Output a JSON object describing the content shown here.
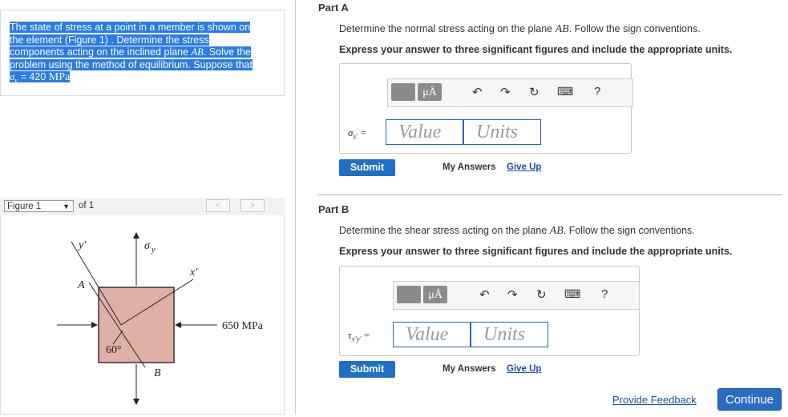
{
  "problem": {
    "line1": "The state of stress at a point in a member is shown on",
    "line2": "the element (Figure 1) . Determine the stress",
    "line3a": "components acting on the inclined plane ",
    "line3b": "AB",
    "line3c": ". Solve the",
    "line4": "problem using the method of equilibrium. Suppose that",
    "sigma_symbol": "σ",
    "sigma_sub": "y",
    "sigma_eq": " = 420 ",
    "sigma_unit": "MPa"
  },
  "figure": {
    "selected": "Figure 1",
    "of_text": "of 1",
    "prev": "<",
    "next": ">",
    "labels": {
      "y_prime": "y′",
      "sigma_y": "σ",
      "sigma_y_sub": "y",
      "x_prime": "x′",
      "A": "A",
      "B": "B",
      "angle": "60°",
      "stress": "650 MPa"
    }
  },
  "partA": {
    "title": "Part A",
    "question_a": "Determine the normal stress acting on the plane ",
    "question_ab": "AB",
    "question_b": ". Follow the sign conventions.",
    "instruction": "Express your answer to three significant figures and include the appropriate units.",
    "var_main": "σ",
    "var_sub": "x′",
    "var_eq": " =",
    "value_placeholder": "Value",
    "units_placeholder": "Units",
    "submit": "Submit",
    "my_answers": "My Answers",
    "give_up": "Give Up"
  },
  "partB": {
    "title": "Part B",
    "question_a": "Determine the shear stress acting on the plane ",
    "question_ab": "AB",
    "question_b": ". Follow the sign conventions.",
    "instruction": "Express your answer to three significant figures and include the appropriate units.",
    "var_main": "τ",
    "var_sub": "x′y′",
    "var_eq": " =",
    "value_placeholder": "Value",
    "units_placeholder": "Units",
    "submit": "Submit",
    "my_answers": "My Answers",
    "give_up": "Give Up"
  },
  "toolbar": {
    "unit_label": "μÅ",
    "help": "?"
  },
  "footer": {
    "feedback": "Provide Feedback",
    "continue": "Continue"
  },
  "colors": {
    "highlight": "#2a7be4",
    "button": "#1f6fc6",
    "element_fill": "#dfb1a6",
    "link": "#1a4f9c"
  }
}
